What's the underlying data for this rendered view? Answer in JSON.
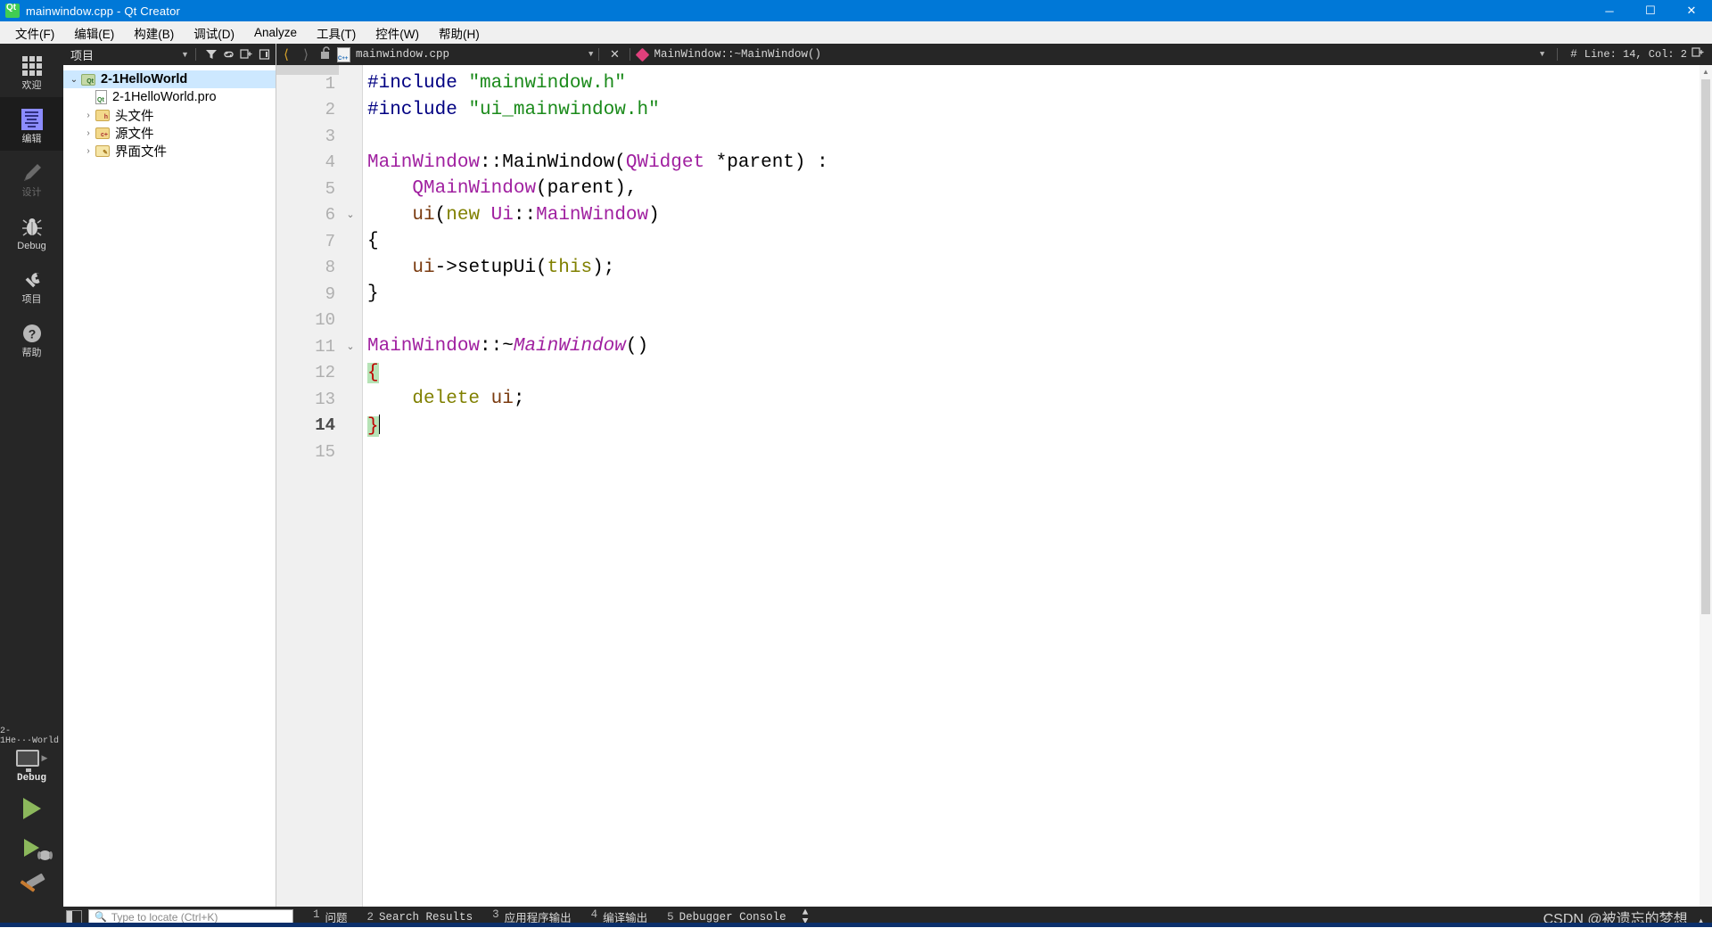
{
  "window": {
    "title": "mainwindow.cpp - Qt Creator",
    "logo_icon": "qt-logo-icon",
    "minimize": "─",
    "maximize": "☐",
    "close": "✕"
  },
  "menubar": {
    "items": [
      {
        "label": "文件(F)",
        "mnemonic": "F"
      },
      {
        "label": "编辑(E)",
        "mnemonic": "E"
      },
      {
        "label": "构建(B)",
        "mnemonic": "B"
      },
      {
        "label": "调试(D)",
        "mnemonic": "D"
      },
      {
        "label": "Analyze",
        "mnemonic": "A"
      },
      {
        "label": "工具(T)",
        "mnemonic": "T"
      },
      {
        "label": "控件(W)",
        "mnemonic": "W"
      },
      {
        "label": "帮助(H)",
        "mnemonic": "H"
      }
    ]
  },
  "modebar": {
    "items": [
      {
        "label": "欢迎",
        "icon": "grid-icon",
        "state": "normal"
      },
      {
        "label": "编辑",
        "icon": "document-lines-icon",
        "state": "active"
      },
      {
        "label": "设计",
        "icon": "pencil-icon",
        "state": "disabled"
      },
      {
        "label": "Debug",
        "icon": "bug-icon",
        "state": "normal"
      },
      {
        "label": "项目",
        "icon": "wrench-icon",
        "state": "normal"
      },
      {
        "label": "帮助",
        "icon": "question-mark-icon",
        "state": "normal"
      }
    ],
    "kit_selector": {
      "project": "2-1He···World",
      "build_config": "Debug",
      "arrow": "▶"
    },
    "run_button": "run-icon",
    "debug_button": "start-debugging-icon",
    "build_button": "build-hammer-icon"
  },
  "project_panel": {
    "header": {
      "combo_label": "项目",
      "combo_arrow": "▼",
      "filter_icon": "filter-icon",
      "link_icon": "link-icon",
      "split_icon": "split-icon",
      "close_icon": "close-panel-icon"
    },
    "tree": [
      {
        "label": "2-1HelloWorld",
        "indent": 0,
        "arrow": "⌄",
        "icon": "project-folder-icon",
        "bold": true,
        "selected": true
      },
      {
        "label": "2-1HelloWorld.pro",
        "indent": 1,
        "arrow": "",
        "icon": "pro-file-icon",
        "bold": false,
        "selected": false
      },
      {
        "label": "头文件",
        "indent": 1,
        "arrow": "›",
        "icon": "headers-folder-icon",
        "bold": false,
        "selected": false
      },
      {
        "label": "源文件",
        "indent": 1,
        "arrow": "›",
        "icon": "sources-folder-icon",
        "bold": false,
        "selected": false
      },
      {
        "label": "界面文件",
        "indent": 1,
        "arrow": "›",
        "icon": "forms-folder-icon",
        "bold": false,
        "selected": false
      }
    ]
  },
  "editor_toolbar": {
    "back_icon": "navigate-back-icon",
    "forward_icon": "navigate-forward-icon",
    "lock_icon": "unlocked-padlock-icon",
    "file_icon": "cpp-file-icon",
    "filename": "mainwindow.cpp",
    "file_dropdown_arrow": "▼",
    "close_icon": "✕",
    "symbol_icon": "function-diamond-icon",
    "symbol": "MainWindow::~MainWindow()",
    "symbol_dropdown_arrow": "▼",
    "line_col_icon": "#",
    "line_col": "Line: 14, Col: 2",
    "split_icon": "split-editor-icon",
    "add_split_icon": "⊞"
  },
  "code": {
    "cursor_line": 14,
    "lines": [
      {
        "n": "1",
        "fold": "",
        "tokens": [
          {
            "t": "#include",
            "c": "pre"
          },
          {
            "t": " ",
            "c": "plain"
          },
          {
            "t": "\"mainwindow.h\"",
            "c": "str"
          }
        ]
      },
      {
        "n": "2",
        "fold": "",
        "tokens": [
          {
            "t": "#include",
            "c": "pre"
          },
          {
            "t": " ",
            "c": "plain"
          },
          {
            "t": "\"ui_mainwindow.h\"",
            "c": "str"
          }
        ]
      },
      {
        "n": "3",
        "fold": "",
        "tokens": []
      },
      {
        "n": "4",
        "fold": "",
        "tokens": [
          {
            "t": "MainWindow",
            "c": "type"
          },
          {
            "t": "::MainWindow(",
            "c": "plain"
          },
          {
            "t": "QWidget",
            "c": "type"
          },
          {
            "t": " *parent) :",
            "c": "plain"
          }
        ]
      },
      {
        "n": "5",
        "fold": "",
        "tokens": [
          {
            "t": "    ",
            "c": "plain"
          },
          {
            "t": "QMainWindow",
            "c": "type"
          },
          {
            "t": "(parent),",
            "c": "plain"
          }
        ]
      },
      {
        "n": "6",
        "fold": "⌄",
        "tokens": [
          {
            "t": "    ",
            "c": "plain"
          },
          {
            "t": "ui",
            "c": "mem"
          },
          {
            "t": "(",
            "c": "plain"
          },
          {
            "t": "new",
            "c": "kw"
          },
          {
            "t": " ",
            "c": "plain"
          },
          {
            "t": "Ui",
            "c": "type"
          },
          {
            "t": "::",
            "c": "plain"
          },
          {
            "t": "MainWindow",
            "c": "type"
          },
          {
            "t": ")",
            "c": "plain"
          }
        ]
      },
      {
        "n": "7",
        "fold": "",
        "tokens": [
          {
            "t": "{",
            "c": "plain"
          }
        ]
      },
      {
        "n": "8",
        "fold": "",
        "tokens": [
          {
            "t": "    ",
            "c": "plain"
          },
          {
            "t": "ui",
            "c": "mem"
          },
          {
            "t": "->setupUi(",
            "c": "plain"
          },
          {
            "t": "this",
            "c": "kw"
          },
          {
            "t": ");",
            "c": "plain"
          }
        ]
      },
      {
        "n": "9",
        "fold": "",
        "tokens": [
          {
            "t": "}",
            "c": "plain"
          }
        ]
      },
      {
        "n": "10",
        "fold": "",
        "tokens": []
      },
      {
        "n": "11",
        "fold": "⌄",
        "tokens": [
          {
            "t": "MainWindow",
            "c": "type"
          },
          {
            "t": "::~",
            "c": "plain"
          },
          {
            "t": "MainWindow",
            "c": "typei"
          },
          {
            "t": "()",
            "c": "plain"
          }
        ]
      },
      {
        "n": "12",
        "fold": "",
        "tokens": [
          {
            "t": "{",
            "c": "brace"
          }
        ]
      },
      {
        "n": "13",
        "fold": "",
        "tokens": [
          {
            "t": "    ",
            "c": "plain"
          },
          {
            "t": "delete",
            "c": "kw"
          },
          {
            "t": " ",
            "c": "plain"
          },
          {
            "t": "ui",
            "c": "mem"
          },
          {
            "t": ";",
            "c": "plain"
          }
        ]
      },
      {
        "n": "14",
        "fold": "",
        "tokens": [
          {
            "t": "}",
            "c": "brace"
          }
        ],
        "caret": true,
        "current": true
      },
      {
        "n": "15",
        "fold": "",
        "tokens": []
      }
    ]
  },
  "statusbar": {
    "toggle_sidebar_icon": "toggle-sidebar-icon",
    "locator": {
      "icon": "search-icon",
      "placeholder": "Type to locate (Ctrl+K)",
      "value": ""
    },
    "output_tabs": [
      {
        "num": "1",
        "label": "问题"
      },
      {
        "num": "2",
        "label": "Search Results"
      },
      {
        "num": "3",
        "label": "应用程序输出"
      },
      {
        "num": "4",
        "label": "编译输出"
      },
      {
        "num": "5",
        "label": "Debugger Console"
      }
    ],
    "updown_icon": "⬍",
    "watermark": "CSDN @被遗忘的梦想",
    "watermark_arrow": "▲"
  },
  "colors": {
    "accent": "#0078d7",
    "modebar_bg": "#262626",
    "editor_bg": "#ffffff",
    "gutter_bg": "#f0f0f0",
    "selection": "#cde8ff",
    "brace_highlight": "#b6e3b6",
    "keyword": "#808000",
    "string": "#1a8a1a",
    "preprocessor": "#000082",
    "type": "#a020a0",
    "member": "#7a3b10",
    "run_green": "#8cb85c"
  }
}
